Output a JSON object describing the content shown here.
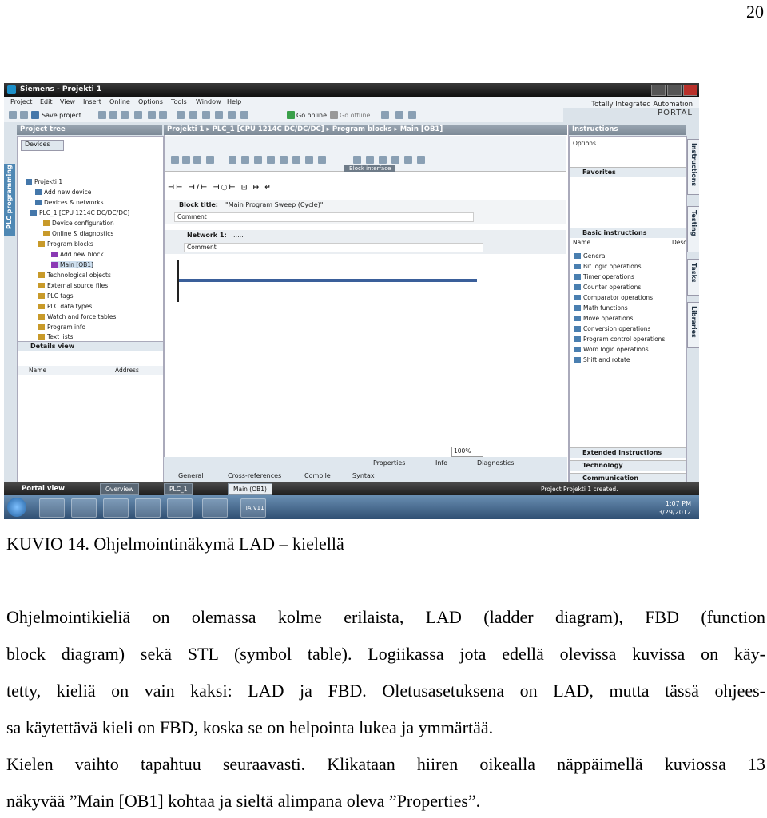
{
  "page_number": "20",
  "screenshot": {
    "window_title": "Siemens - Projekti 1",
    "menu": [
      "Project",
      "Edit",
      "View",
      "Insert",
      "Online",
      "Options",
      "Tools",
      "Window",
      "Help"
    ],
    "brand_line1": "Totally Integrated Automation",
    "brand_line2": "PORTAL",
    "toolbar": {
      "save": "Save project",
      "go_online": "Go online",
      "go_offline": "Go offline"
    },
    "project_tree": {
      "title": "Project tree",
      "devices_tab": "Devices",
      "side_tab": "PLC programming",
      "items": [
        "Projekti 1",
        "Add new device",
        "Devices & networks",
        "PLC_1 [CPU 1214C DC/DC/DC]",
        "Device configuration",
        "Online & diagnostics",
        "Program blocks",
        "Add new block",
        "Main [OB1]",
        "Technological objects",
        "External source files",
        "PLC tags",
        "PLC data types",
        "Watch and force tables",
        "Program info",
        "Text lists"
      ]
    },
    "details_view": {
      "title": "Details view",
      "col_name": "Name",
      "col_address": "Address"
    },
    "editor": {
      "breadcrumb": "Projekti 1 ▸ PLC_1 [CPU 1214C DC/DC/DC] ▸ Program blocks ▸ Main [OB1]",
      "block_interface": "Block interface",
      "lad_tools": "⊣⊢ ⊣/⊢ ⊣○⊢ ⊡ ↦ ↵",
      "block_title_label": "Block title:",
      "block_title_value": "\"Main Program Sweep (Cycle)\"",
      "comment": "Comment",
      "network_label": "Network 1:",
      "network_value": ".....",
      "network_comment": "Comment",
      "zoom": "100%"
    },
    "inspector": {
      "properties": "Properties",
      "info": "Info",
      "diagnostics": "Diagnostics",
      "tabs": [
        "General",
        "Cross-references",
        "Compile",
        "Syntax"
      ]
    },
    "instructions": {
      "title": "Instructions",
      "options": "Options",
      "favorites": "Favorites",
      "basic": "Basic instructions",
      "col_name": "Name",
      "col_desc": "Desc",
      "items": [
        "General",
        "Bit logic operations",
        "Timer operations",
        "Counter operations",
        "Comparator operations",
        "Math functions",
        "Move operations",
        "Conversion operations",
        "Program control operations",
        "Word logic operations",
        "Shift and rotate"
      ],
      "extended": "Extended instructions",
      "technology": "Technology",
      "communication": "Communication",
      "side_tabs": [
        "Instructions",
        "Testing",
        "Tasks",
        "Libraries"
      ]
    },
    "portal_bar": {
      "portal_view": "Portal view",
      "tabs": [
        "Overview",
        "PLC_1",
        "Main (OB1)"
      ],
      "status": "Project Projekti 1 created."
    },
    "taskbar": {
      "time": "1:07 PM",
      "date": "3/29/2012",
      "tia_label": "TIA V11"
    }
  },
  "caption": "KUVIO 14. Ohjelmointinäkymä LAD – kielellä",
  "paragraph1_lines": [
    "Ohjelmointikieliä on olemassa kolme erilaista, LAD (ladder diagram), FBD (function",
    "block diagram) sekä STL (symbol table). Logiikassa jota edellä olevissa kuvissa on käy-",
    "tetty, kieliä on vain kaksi: LAD ja FBD. Oletusasetuksena on LAD, mutta tässä ohjees-",
    "sa käytettävä kieli on FBD, koska se on helpointa lukea ja ymmärtää."
  ],
  "paragraph2_lines": [
    "Kielen vaihto tapahtuu seuraavasti. Klikataan hiiren oikealla näppäimellä kuviossa 13",
    "näkyvää ”Main [OB1] kohtaa ja sieltä alimpana oleva ”Properties”."
  ]
}
